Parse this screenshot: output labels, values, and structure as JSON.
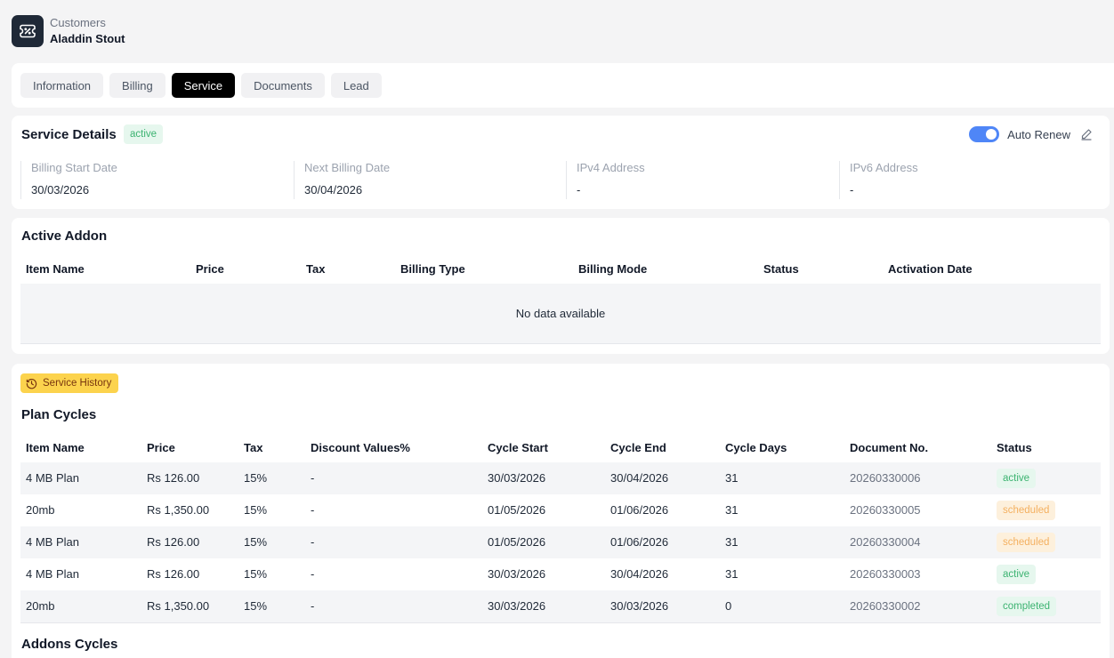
{
  "breadcrumb": {
    "parent": "Customers",
    "current": "Aladdin Stout"
  },
  "tabs": [
    {
      "label": "Information",
      "active": false
    },
    {
      "label": "Billing",
      "active": false
    },
    {
      "label": "Service",
      "active": true
    },
    {
      "label": "Documents",
      "active": false
    },
    {
      "label": "Lead",
      "active": false
    }
  ],
  "service_details": {
    "title": "Service Details",
    "status": "active",
    "auto_renew_label": "Auto Renew",
    "auto_renew_on": true,
    "fields": [
      {
        "label": "Billing Start Date",
        "value": "30/03/2026"
      },
      {
        "label": "Next Billing Date",
        "value": "30/04/2026"
      },
      {
        "label": "IPv4 Address",
        "value": "-"
      },
      {
        "label": "IPv6 Address",
        "value": "-"
      }
    ]
  },
  "active_addon": {
    "title": "Active Addon",
    "columns": [
      "Item Name",
      "Price",
      "Tax",
      "Billing Type",
      "Billing Mode",
      "Status",
      "Activation Date"
    ],
    "empty_text": "No data available"
  },
  "service_history": {
    "chip_label": "Service History",
    "plan_cycles_title": "Plan Cycles",
    "columns": [
      "Item Name",
      "Price",
      "Tax",
      "Discount Values%",
      "Cycle Start",
      "Cycle End",
      "Cycle Days",
      "Document No.",
      "Status"
    ],
    "rows": [
      {
        "item": "4 MB Plan",
        "price": "Rs 126.00",
        "tax": "15%",
        "discount": "-",
        "start": "30/03/2026",
        "end": "30/04/2026",
        "days": "31",
        "doc": "20260330006",
        "status": "active"
      },
      {
        "item": "20mb",
        "price": "Rs 1,350.00",
        "tax": "15%",
        "discount": "-",
        "start": "01/05/2026",
        "end": "01/06/2026",
        "days": "31",
        "doc": "20260330005",
        "status": "scheduled"
      },
      {
        "item": "4 MB Plan",
        "price": "Rs 126.00",
        "tax": "15%",
        "discount": "-",
        "start": "01/05/2026",
        "end": "01/06/2026",
        "days": "31",
        "doc": "20260330004",
        "status": "scheduled"
      },
      {
        "item": "4 MB Plan",
        "price": "Rs 126.00",
        "tax": "15%",
        "discount": "-",
        "start": "30/03/2026",
        "end": "30/04/2026",
        "days": "31",
        "doc": "20260330003",
        "status": "active"
      },
      {
        "item": "20mb",
        "price": "Rs 1,350.00",
        "tax": "15%",
        "discount": "-",
        "start": "30/03/2026",
        "end": "30/03/2026",
        "days": "0",
        "doc": "20260330002",
        "status": "completed"
      }
    ],
    "addons_cycles_title": "Addons Cycles"
  },
  "colors": {
    "accent_toggle": "#4f86f7",
    "active_tab": "#000000",
    "status_active": "#3cb371",
    "status_scheduled": "#f4b060",
    "history_chip": "#fcd34d"
  },
  "icons": {
    "logo": "app-logo-icon",
    "edit": "pencil-icon",
    "history": "clock-history-icon"
  }
}
